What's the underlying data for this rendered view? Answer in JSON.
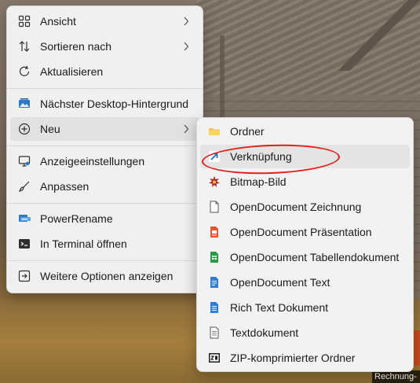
{
  "context_menu": {
    "items": [
      {
        "label": "Ansicht",
        "icon": "grid-view-icon",
        "has_submenu": true
      },
      {
        "label": "Sortieren nach",
        "icon": "sort-arrows-icon",
        "has_submenu": true
      },
      {
        "label": "Aktualisieren",
        "icon": "refresh-icon",
        "has_submenu": false
      },
      {
        "label": "Nächster Desktop-Hintergrund",
        "icon": "next-wallpaper-icon",
        "has_submenu": false
      },
      {
        "label": "Neu",
        "icon": "new-plus-icon",
        "has_submenu": true,
        "highlighted": true
      },
      {
        "label": "Anzeigeeinstellungen",
        "icon": "display-settings-icon",
        "has_submenu": false
      },
      {
        "label": "Anpassen",
        "icon": "brush-icon",
        "has_submenu": false
      },
      {
        "label": "PowerRename",
        "icon": "powerrename-icon",
        "has_submenu": false
      },
      {
        "label": "In Terminal öffnen",
        "icon": "terminal-icon",
        "has_submenu": false
      },
      {
        "label": "Weitere Optionen anzeigen",
        "icon": "more-options-icon",
        "has_submenu": false
      }
    ]
  },
  "new_submenu": {
    "items": [
      {
        "label": "Ordner",
        "icon": "folder-icon"
      },
      {
        "label": "Verknüpfung",
        "icon": "shortcut-arrow-icon",
        "highlighted": true
      },
      {
        "label": "Bitmap-Bild",
        "icon": "bitmap-icon"
      },
      {
        "label": "OpenDocument Zeichnung",
        "icon": "document-blank-icon"
      },
      {
        "label": "OpenDocument Präsentation",
        "icon": "presentation-icon"
      },
      {
        "label": "OpenDocument Tabellendokument",
        "icon": "spreadsheet-icon"
      },
      {
        "label": "OpenDocument Text",
        "icon": "text-document-icon"
      },
      {
        "label": "Rich Text Dokument",
        "icon": "rich-text-icon"
      },
      {
        "label": "Textdokument",
        "icon": "notepad-icon"
      },
      {
        "label": "ZIP-komprimierter Ordner",
        "icon": "zip-archive-icon"
      }
    ]
  },
  "desktop": {
    "partial_label": "Rechnung-"
  },
  "colors": {
    "menu_bg": "#f0f0f0",
    "highlight": "#e1e1e1",
    "accent_blue": "#0f6cbd",
    "annotation_red": "#e0201a"
  }
}
